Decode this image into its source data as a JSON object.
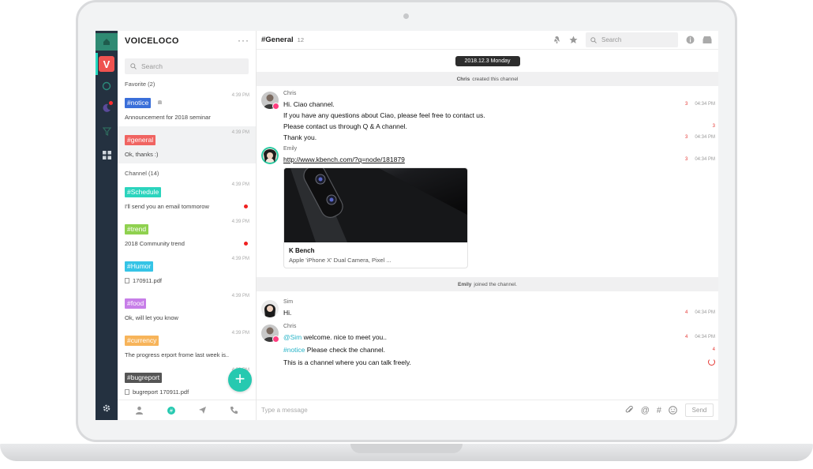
{
  "app": {
    "brand": "VOICELOCO",
    "rail_v": "V",
    "more": "···"
  },
  "list": {
    "search_placeholder": "Search",
    "favorite_header": "Favorite (2)",
    "channel_header": "Channel (14)",
    "favorites": [
      {
        "tag": "#notice",
        "color": "#3a6fd9",
        "preview": "Announcement for 2018 seminar",
        "time": "4:39 PM",
        "muted": true
      },
      {
        "tag": "#general",
        "color": "#f06461",
        "preview": "Ok, thanks :)",
        "time": "4:39 PM",
        "selected": true
      }
    ],
    "channels": [
      {
        "tag": "#Schedule",
        "color": "#2bd4bd",
        "preview": "I'll send you an email tommorow",
        "time": "4:39 PM",
        "unread": true
      },
      {
        "tag": "#trend",
        "color": "#8fd14f",
        "preview": "2018 Community trend",
        "time": "4:39 PM",
        "unread": true
      },
      {
        "tag": "#Humor",
        "color": "#35c4e6",
        "preview": "170911.pdf",
        "time": "4:39 PM",
        "file": true
      },
      {
        "tag": "#food",
        "color": "#c77ee8",
        "preview": "Ok, will let you know",
        "time": "4:39 PM"
      },
      {
        "tag": "#currency",
        "color": "#f7b45a",
        "preview": "The progress erport frome last week is..",
        "time": "4:39 PM"
      },
      {
        "tag": "#bugreport",
        "color": "#555555",
        "preview": "bugreport 170911.pdf",
        "time": "4:39 PM",
        "file": true
      }
    ]
  },
  "chat": {
    "title": "#General",
    "count": "12",
    "search_placeholder": "Search",
    "date": "2018.12.3 Monday",
    "created_user": "Chris",
    "created_text": "created this channel",
    "joined_user": "Emily",
    "joined_text": "joined the channel.",
    "composer_placeholder": "Type a message",
    "send_label": "Send",
    "m1": {
      "name": "Chris",
      "l1": "Hi. Ciao channel.",
      "l1_n": "3",
      "l1_t": "04:34 PM",
      "l2": "If you have any questions about Ciao, please feel free to contact us.",
      "l3": "Please contact us through Q & A channel.",
      "l3_n": "3",
      "l4": "Thank you.",
      "l4_n": "3",
      "l4_t": "04:34 PM"
    },
    "m2": {
      "name": "Emily",
      "link": "http://www.kbench.com/?q=node/181879",
      "link_n": "3",
      "link_t": "04:34 PM",
      "card_title": "K Bench",
      "card_sub": "Apple 'iPhone X' Dual Camera, Pixel ..."
    },
    "m3": {
      "name": "Sim",
      "l1": "Hi.",
      "l1_n": "4",
      "l1_t": "04:34 PM"
    },
    "m4": {
      "name": "Chris",
      "mention": "@Sim",
      "l1": " welcome. nice to meet you..",
      "l1_n": "4",
      "l1_t": "04:34 PM",
      "channel_tag": "#notice",
      "l2": " Please check the channel.",
      "l2_n": "4",
      "l3": "This is a channel where you can talk freely."
    }
  }
}
